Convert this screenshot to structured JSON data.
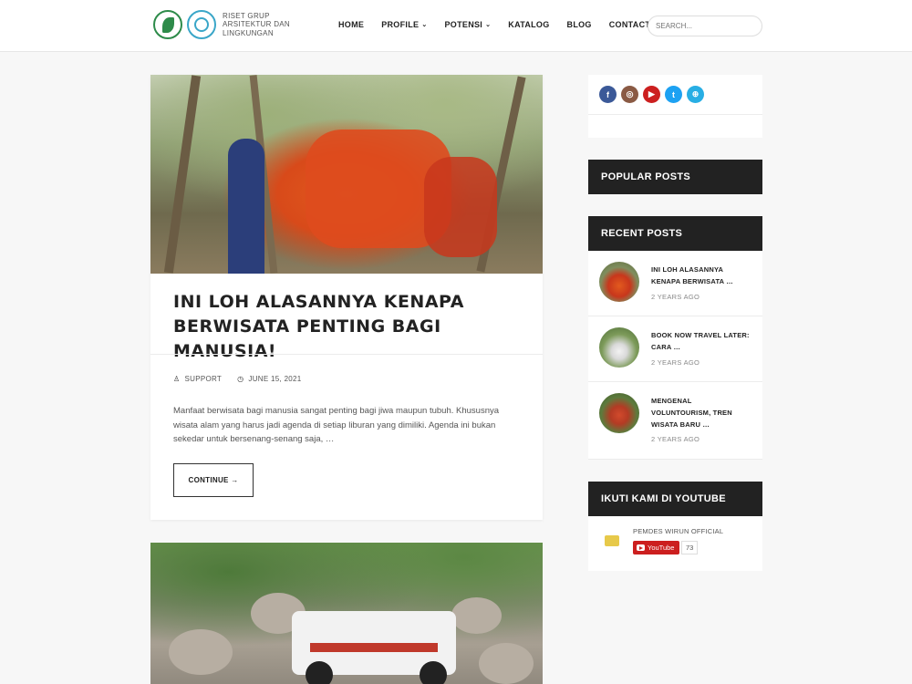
{
  "header": {
    "logo_text": "RISET GRUP ARSITEKTUR DAN LINGKUNGAN",
    "nav": [
      {
        "label": "HOME",
        "dropdown": false
      },
      {
        "label": "PROFILE",
        "dropdown": true
      },
      {
        "label": "POTENSI",
        "dropdown": true
      },
      {
        "label": "KATALOG",
        "dropdown": false
      },
      {
        "label": "BLOG",
        "dropdown": false
      },
      {
        "label": "CONTACT",
        "dropdown": false
      }
    ],
    "search_placeholder": "SEARCH..."
  },
  "post": {
    "title": "INI LOH ALASANNYA KENAPA BERWISATA PENTING BAGI MANUSIA!",
    "author": "SUPPORT",
    "date": "JUNE 15, 2021",
    "excerpt": "Manfaat berwisata bagi manusia sangat penting bagi jiwa maupun tubuh. Khususnya wisata alam yang harus jadi agenda di setiap liburan yang dimiliki. Agenda ini bukan sekedar untuk bersenang-senang saja, …",
    "continue_label": "CONTINUE →"
  },
  "sidebar": {
    "social": [
      {
        "name": "facebook-icon",
        "glyph": "f",
        "color": "#3b5998"
      },
      {
        "name": "instagram-icon",
        "glyph": "◎",
        "color": "#8a5a44"
      },
      {
        "name": "youtube-icon",
        "glyph": "▶",
        "color": "#cc1f1f"
      },
      {
        "name": "twitter-icon",
        "glyph": "t",
        "color": "#1da1f2"
      },
      {
        "name": "globe-icon",
        "glyph": "⊕",
        "color": "#28aee4"
      }
    ],
    "popular_title": "POPULAR POSTS",
    "recent_title": "RECENT POSTS",
    "recent": [
      {
        "title": "INI LOH ALASANNYA KENAPA BERWISATA …",
        "date": "2 YEARS AGO"
      },
      {
        "title": "BOOK NOW TRAVEL LATER: CARA …",
        "date": "2 YEARS AGO"
      },
      {
        "title": "MENGENAL VOLUNTOURISM, TREN WISATA BARU …",
        "date": "2 YEARS AGO"
      }
    ],
    "youtube_title": "IKUTI KAMI DI YOUTUBE",
    "youtube_channel": "PEMDES WIRUN OFFICIAL",
    "youtube_button": "YouTube",
    "youtube_count": "73"
  }
}
